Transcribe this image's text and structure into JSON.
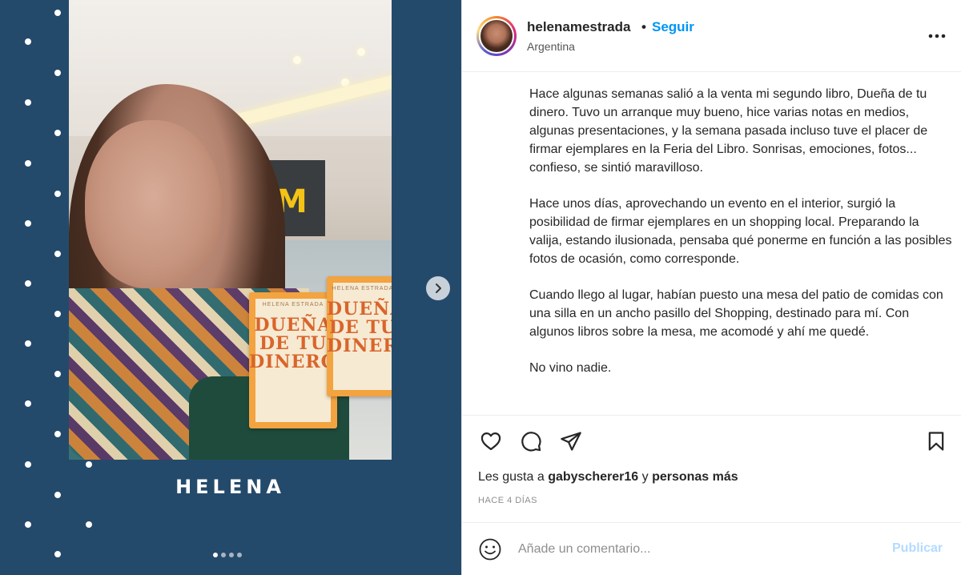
{
  "media": {
    "caption_name": "HELENA",
    "book_title": "DUEÑA DE TU DINERO",
    "book_author": "HELENA ESTRADA",
    "carousel_total": 4,
    "carousel_active": 1
  },
  "header": {
    "username": "helenamestrada",
    "separator": "•",
    "follow_label": "Seguir",
    "location": "Argentina"
  },
  "caption": {
    "paragraphs": [
      "Hace algunas semanas salió a la venta mi segundo libro, Dueña de tu dinero. Tuvo un arranque muy bueno, hice varias notas en medios, algunas presentaciones, y la semana pasada incluso tuve el placer de firmar ejemplares en la Feria del Libro. Sonrisas, emociones, fotos... confieso, se sintió maravilloso.",
      "Hace unos días, aprovechando un evento en el interior, surgió la posibilidad de firmar ejemplares en un shopping local. Preparando la valija, estando ilusionada, pensaba qué ponerme en función a las posibles fotos de ocasión, como corresponde.",
      "Cuando llego al lugar, habían puesto una mesa del patio de comidas con una silla en un ancho pasillo del Shopping, destinado para mí. Con algunos libros sobre la mesa, me acomodé y ahí me quedé.",
      "No vino nadie."
    ]
  },
  "actions": {
    "icons": [
      "heart-icon",
      "comment-icon",
      "share-icon",
      "bookmark-icon"
    ],
    "likes_prefix": "Les gusta a",
    "likes_user": "gabyscherer16",
    "likes_conj": "y",
    "likes_more": "personas más",
    "time_ago": "HACE 4 DÍAS"
  },
  "comment": {
    "placeholder": "Añade un comentario...",
    "publish_label": "Publicar"
  },
  "colors": {
    "media_bg": "#244a6b",
    "link_blue": "#0095f6",
    "publish_disabled": "#b3dbff"
  }
}
